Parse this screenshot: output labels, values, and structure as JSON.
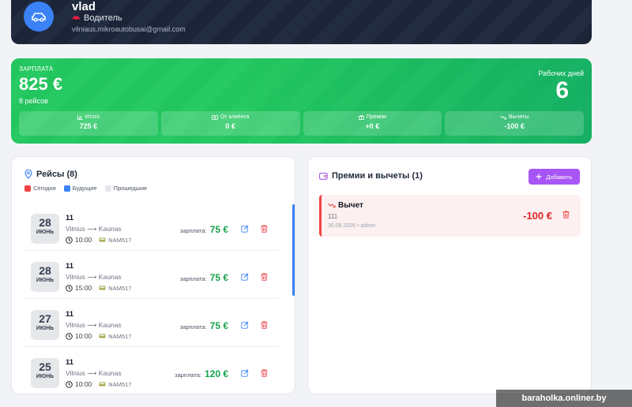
{
  "profile": {
    "name": "vlad",
    "role": "Водитель",
    "email": "vilniaus.mikroautobusai@gmail.com"
  },
  "salary": {
    "label": "ЗАРПЛАТА",
    "amount": "825 €",
    "trips_count": "8 рейсов",
    "work_days_label": "Рабочих дней",
    "work_days": "6",
    "stats": [
      {
        "label": "Итого",
        "value": "725 €",
        "icon": "chart-icon"
      },
      {
        "label": "От клиента",
        "value": "0 €",
        "icon": "cash-icon"
      },
      {
        "label": "Премии",
        "value": "+0 €",
        "icon": "gift-icon"
      },
      {
        "label": "Вычеты",
        "value": "-100 €",
        "icon": "trend-down-icon"
      }
    ]
  },
  "trips": {
    "title": "Рейсы (8)",
    "legend": [
      {
        "label": "Сегодня",
        "color": "#ef4444"
      },
      {
        "label": "Будущие",
        "color": "#3b82f6"
      },
      {
        "label": "Прошедшие",
        "color": "#e5e7eb"
      }
    ],
    "salary_label": "зарплата:",
    "items": [
      {
        "day": "28",
        "month": "ИЮНЬ",
        "number": "11",
        "route": "Vilnius ⟶ Kaunas",
        "time": "10:00",
        "plate": "NAM517",
        "salary": "75 €"
      },
      {
        "day": "28",
        "month": "ИЮНЬ",
        "number": "11",
        "route": "Vilnius ⟶ Kaunas",
        "time": "15:00",
        "plate": "NAM517",
        "salary": "75 €"
      },
      {
        "day": "27",
        "month": "ИЮНЬ",
        "number": "11",
        "route": "Vilnius ⟶ Kaunas",
        "time": "10:00",
        "plate": "NAM517",
        "salary": "75 €"
      },
      {
        "day": "25",
        "month": "ИЮНЬ",
        "number": "11",
        "route": "Vilnius ⟶ Kaunas",
        "time": "10:00",
        "plate": "NAM517",
        "salary": "120 €"
      }
    ]
  },
  "bonuses": {
    "title": "Премии и вычеты (1)",
    "add_label": "Добавить",
    "items": [
      {
        "type": "Вычет",
        "note": "111",
        "meta": "30.06.2026 • admin",
        "amount": "-100 €"
      }
    ]
  },
  "watermark": "baraholka.onliner.by"
}
